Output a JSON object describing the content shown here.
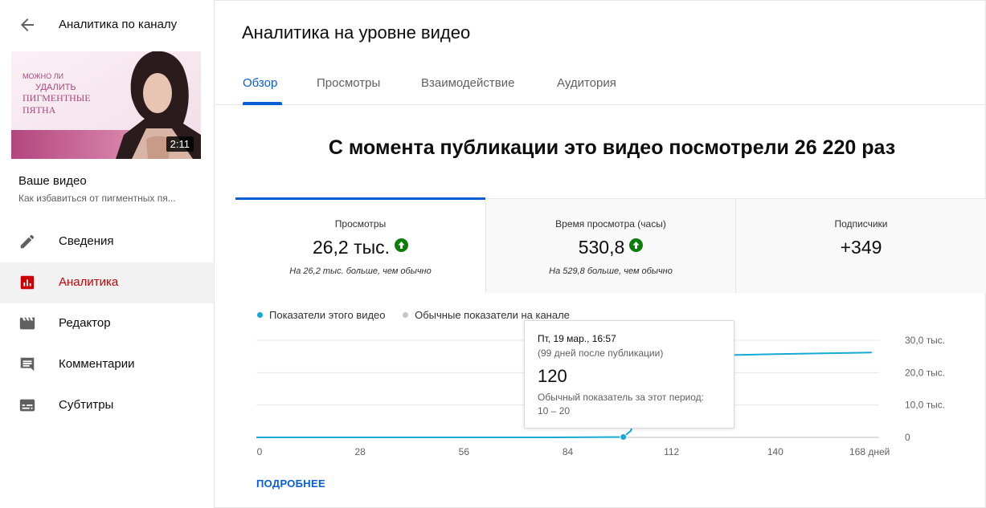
{
  "sidebar": {
    "title": "Аналитика по каналу",
    "thumbnail": {
      "duration": "2:11",
      "text_lines": [
        "МОЖНО ЛИ",
        "УДАЛИТЬ",
        "ПИГМЕНТНЫЕ",
        "ПЯТНА"
      ]
    },
    "your_video_label": "Ваше видео",
    "video_title": "Как избавиться от пигментных пя...",
    "items": [
      {
        "label": "Сведения",
        "icon": "pencil-icon"
      },
      {
        "label": "Аналитика",
        "icon": "analytics-icon",
        "active": true
      },
      {
        "label": "Редактор",
        "icon": "clapperboard-icon"
      },
      {
        "label": "Комментарии",
        "icon": "comment-icon"
      },
      {
        "label": "Субтитры",
        "icon": "subtitles-icon"
      }
    ]
  },
  "main": {
    "title": "Аналитика на уровне видео",
    "tabs": [
      {
        "label": "Обзор",
        "active": true
      },
      {
        "label": "Просмотры"
      },
      {
        "label": "Взаимодействие"
      },
      {
        "label": "Аудитория"
      }
    ],
    "headline": "С момента публикации это видео посмотрели 26 220 раз",
    "metrics": [
      {
        "label": "Просмотры",
        "value": "26,2 тыс.",
        "trend": "up",
        "note": "На 26,2 тыс. больше, чем обычно"
      },
      {
        "label": "Время просмотра (часы)",
        "value": "530,8",
        "trend": "up",
        "note": "На 529,8 больше, чем обычно"
      },
      {
        "label": "Подписчики",
        "value": "+349"
      }
    ],
    "legend": {
      "this_video": "Показатели этого видео",
      "typical": "Обычные показатели на канале"
    },
    "tooltip": {
      "date": "Пт, 19 мар., 16:57",
      "days": "(99 дней после публикации)",
      "value": "120",
      "typical_label": "Обычный показатель за этот период:",
      "typical_range": "10 – 20"
    },
    "more_link": "ПОДРОБНЕЕ"
  },
  "colors": {
    "accent_blue": "#065fd4",
    "active_red": "#cc0000",
    "series_line": "#14a9d6",
    "typical_dot": "#c4c4c4",
    "trend_green": "#0a7e07"
  },
  "chart_data": {
    "type": "line",
    "x_tick_labels": [
      "0",
      "28",
      "56",
      "84",
      "112",
      "140",
      "168 дней"
    ],
    "x_ticks": [
      0,
      28,
      56,
      84,
      112,
      140,
      168
    ],
    "y_tick_labels": [
      "0",
      "10,0 тыс.",
      "20,0 тыс.",
      "30,0 тыс."
    ],
    "y_ticks": [
      0,
      10000,
      20000,
      30000
    ],
    "xlim": [
      0,
      168
    ],
    "ylim": [
      0,
      30000
    ],
    "grid": true,
    "series": [
      {
        "name": "Показатели этого видео",
        "x": [
          0,
          20,
          40,
          60,
          80,
          99,
          101,
          103,
          104,
          105,
          106,
          108,
          112,
          120,
          130,
          140,
          150,
          160,
          166
        ],
        "y": [
          0,
          0,
          0,
          0,
          0,
          120,
          2000,
          8000,
          14000,
          20000,
          24000,
          25000,
          25200,
          25400,
          25500,
          25700,
          25900,
          26100,
          26220
        ]
      }
    ],
    "highlight_point": {
      "x": 99,
      "y": 120
    }
  }
}
